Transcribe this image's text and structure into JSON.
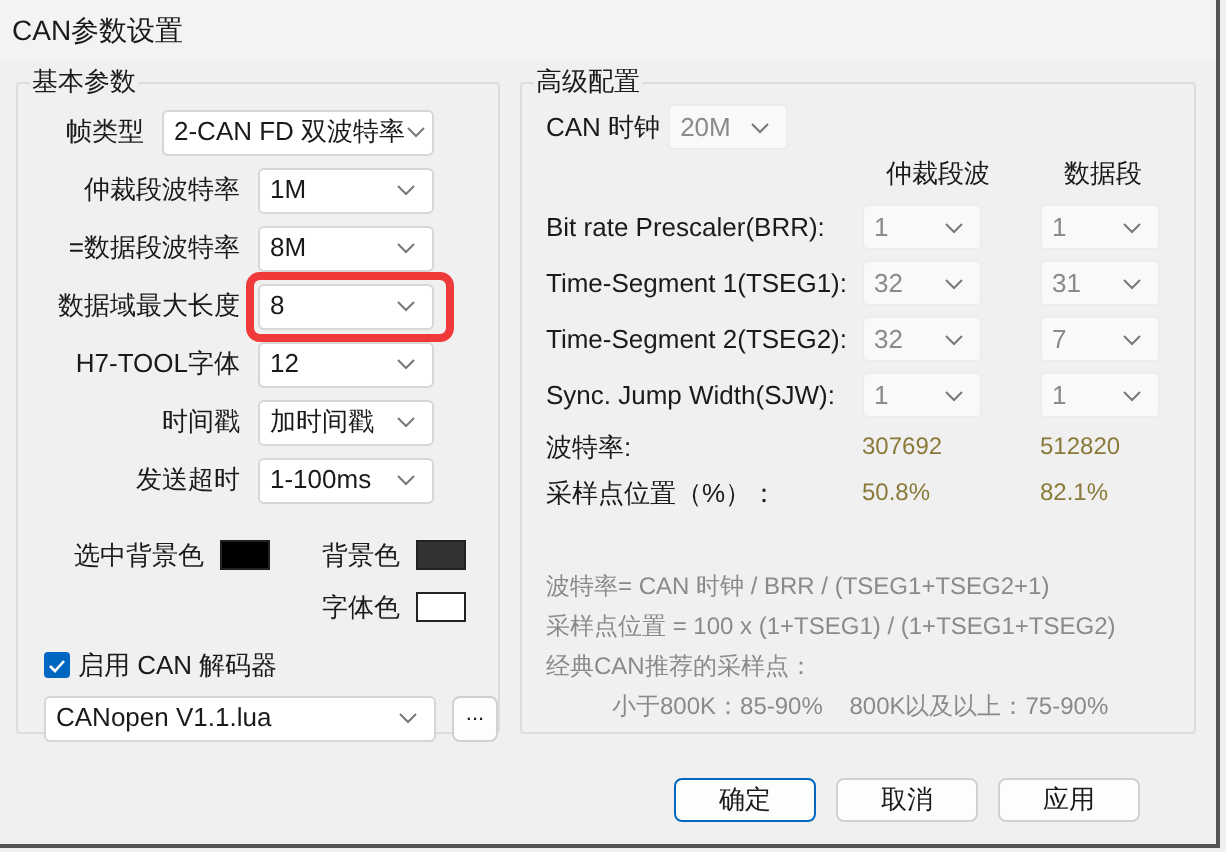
{
  "window": {
    "title": "CAN参数设置"
  },
  "basic": {
    "title": "基本参数",
    "fields": [
      {
        "label": "帧类型",
        "value": "2-CAN FD 双波特率",
        "highlighted": false
      },
      {
        "label": "仲裁段波特率",
        "value": "1M",
        "highlighted": false
      },
      {
        "label": "=数据段波特率",
        "value": "8M",
        "highlighted": false
      },
      {
        "label": "数据域最大长度",
        "value": "8",
        "highlighted": true
      },
      {
        "label": "H7-TOOL字体",
        "value": "12",
        "highlighted": false
      },
      {
        "label": "时间戳",
        "value": "加时间戳",
        "highlighted": false
      },
      {
        "label": "发送超时",
        "value": "1-100ms",
        "highlighted": false
      }
    ],
    "colors": [
      {
        "label": "选中背景色",
        "color": "#000000"
      },
      {
        "label": "背景色",
        "color": "#333333"
      },
      {
        "label": "字体色",
        "color": "#ffffff"
      }
    ],
    "decoder": {
      "label": "启用 CAN 解码器",
      "checked": true,
      "file": "CANopen V1.1.lua",
      "browse": "..."
    }
  },
  "advanced": {
    "title": "高级配置",
    "clock": {
      "label": "CAN 时钟",
      "value": "20M",
      "disabled": true
    },
    "columns": [
      "仲裁段波",
      "数据段"
    ],
    "rows": [
      {
        "label": "Bit rate  Prescaler(BRR):",
        "values": [
          "1",
          "1"
        ],
        "disabled": true
      },
      {
        "label": "Time-Segment 1(TSEG1):",
        "values": [
          "32",
          "31"
        ],
        "disabled": true
      },
      {
        "label": "Time-Segment 2(TSEG2):",
        "values": [
          "32",
          "7"
        ],
        "disabled": true
      },
      {
        "label": "Sync. Jump Width(SJW):",
        "values": [
          "1",
          "1"
        ],
        "disabled": true
      }
    ],
    "results": [
      {
        "label": "波特率:",
        "values": [
          "307692",
          "512820"
        ]
      },
      {
        "label": "采样点位置（%）：",
        "values": [
          "50.8%",
          "82.1%"
        ]
      }
    ],
    "notes": [
      "波特率= CAN 时钟 / BRR / (TSEG1+TSEG2+1)",
      "采样点位置 = 100 x (1+TSEG1) / (1+TSEG1+TSEG2)",
      "经典CAN推荐的采样点："
    ],
    "footnote": "小于800K：85-90%    800K以及以上：75-90%"
  },
  "buttons": [
    {
      "label": "确定",
      "default": true
    },
    {
      "label": "取消",
      "default": false
    },
    {
      "label": "应用",
      "default": false
    }
  ]
}
